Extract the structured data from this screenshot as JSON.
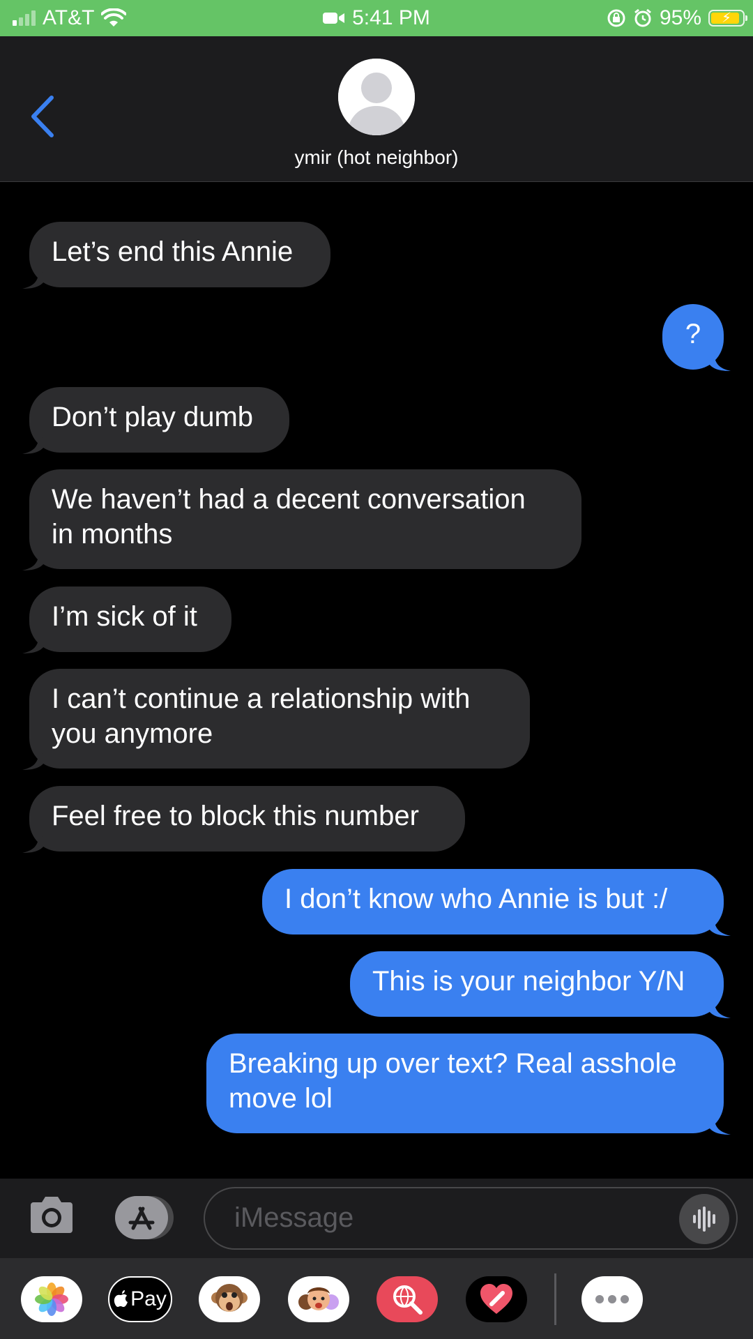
{
  "status_bar": {
    "carrier": "AT&T",
    "time": "5:41 PM",
    "battery": "95%",
    "battery_level": 0.95
  },
  "header": {
    "contact_name": "ymir (hot neighbor)"
  },
  "messages": [
    {
      "direction": "incoming",
      "lines": [
        "Let’s end this Annie"
      ]
    },
    {
      "direction": "outgoing",
      "lines": [
        "?"
      ]
    },
    {
      "direction": "incoming",
      "lines": [
        "Don’t play dumb"
      ]
    },
    {
      "direction": "incoming",
      "lines": [
        "We haven’t had a decent conversation",
        "in months"
      ]
    },
    {
      "direction": "incoming",
      "lines": [
        "I’m sick of it"
      ]
    },
    {
      "direction": "incoming",
      "lines": [
        "I can’t continue a relationship with",
        "you anymore"
      ]
    },
    {
      "direction": "incoming",
      "lines": [
        "Feel free to block this number"
      ]
    },
    {
      "direction": "outgoing",
      "lines": [
        "I don’t know who Annie is but :/"
      ]
    },
    {
      "direction": "outgoing",
      "lines": [
        "This is your neighbor Y/N"
      ]
    },
    {
      "direction": "outgoing",
      "lines": [
        "Breaking up over text? Real asshole",
        "move lol"
      ]
    }
  ],
  "input": {
    "placeholder": "iMessage"
  },
  "app_drawer": {
    "apps": [
      "photos-icon",
      "apple-pay-icon",
      "animoji-icon",
      "memoji-icon",
      "web-images-icon",
      "digital-touch-icon",
      "more-icon"
    ],
    "apple_pay_label": "Pay"
  },
  "colors": {
    "status_bar": "#65c466",
    "outgoing_bubble": "#3a80f0",
    "incoming_bubble": "#2c2c2e",
    "accent": "#3a80f0"
  }
}
